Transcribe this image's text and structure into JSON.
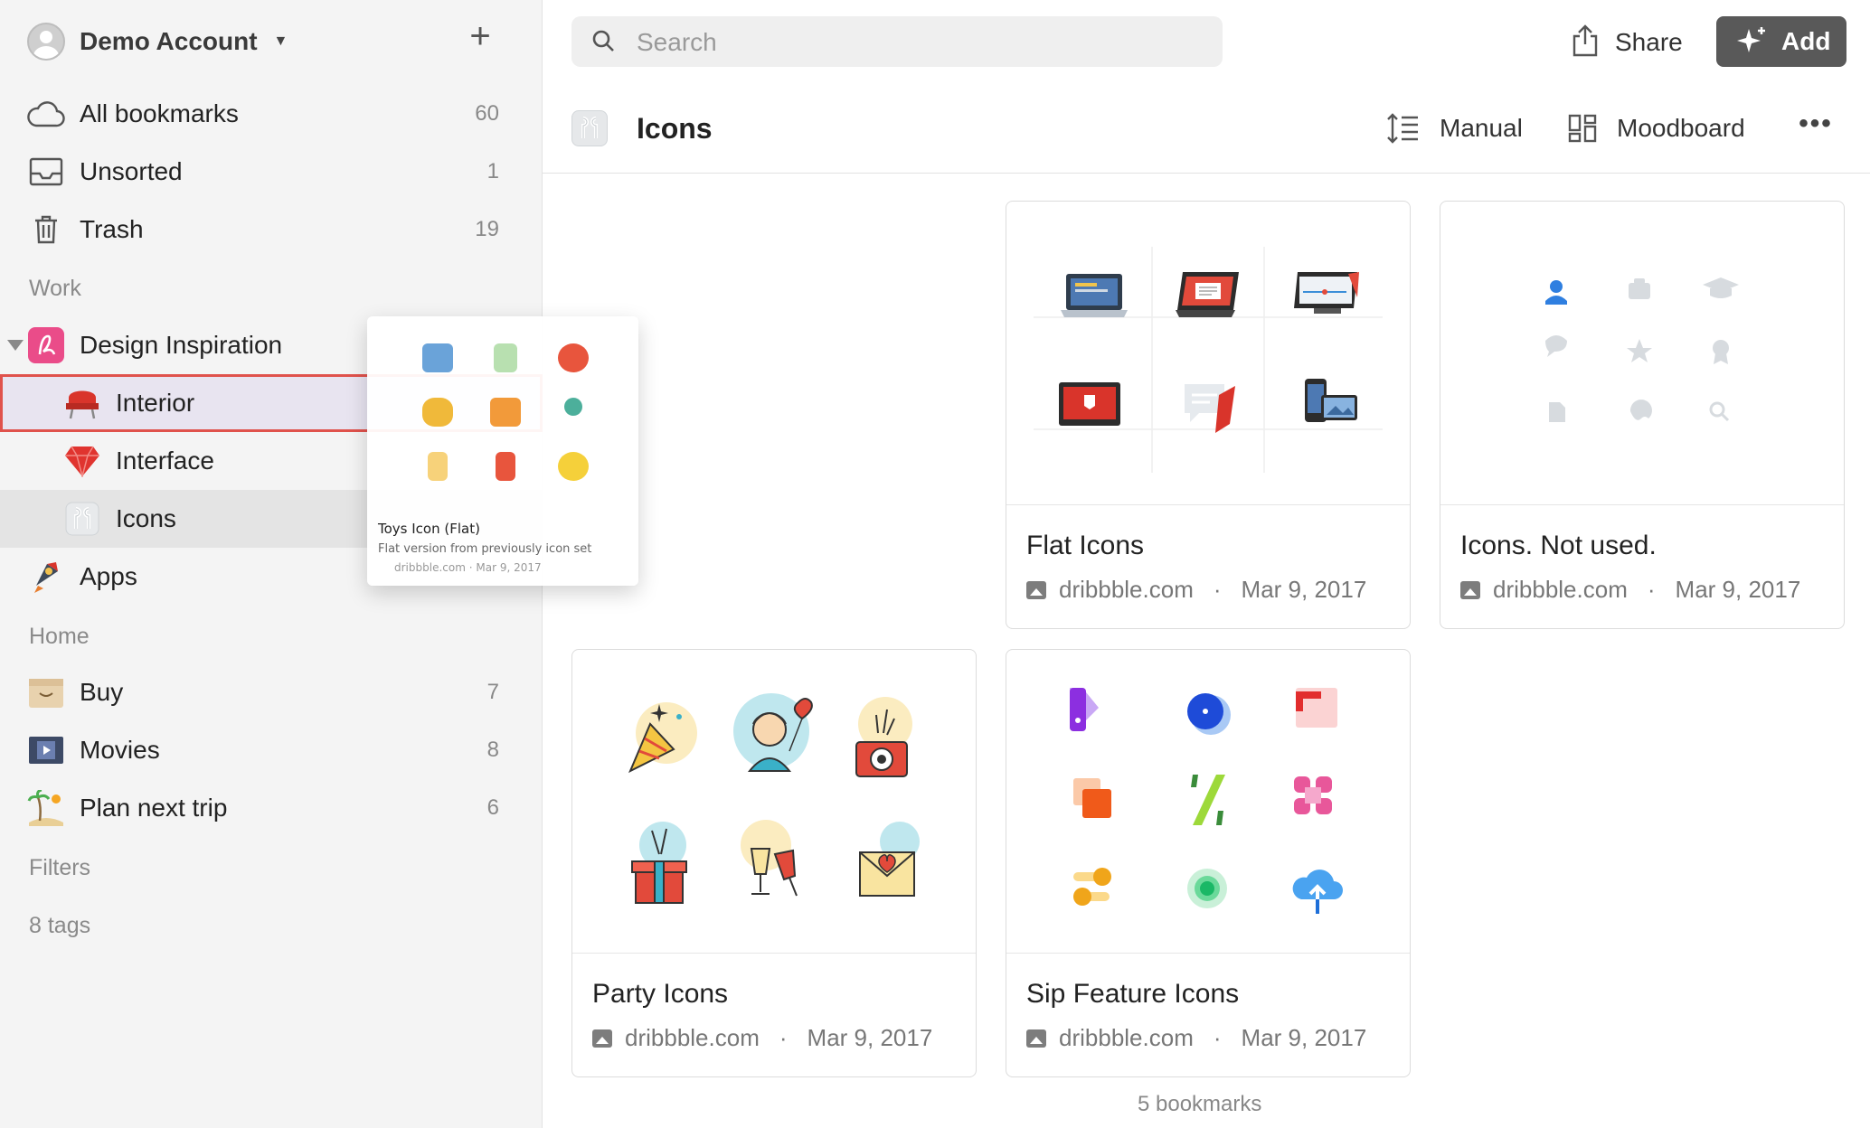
{
  "account": {
    "name": "Demo Account"
  },
  "sidebar": {
    "system": [
      {
        "label": "All bookmarks",
        "count": "60",
        "icon": "cloud-icon"
      },
      {
        "label": "Unsorted",
        "count": "1",
        "icon": "inbox-icon"
      },
      {
        "label": "Trash",
        "count": "19",
        "icon": "trash-icon"
      }
    ],
    "sections": {
      "work": "Work",
      "home": "Home",
      "filters": "Filters",
      "tags": "8 tags"
    },
    "work_items": [
      {
        "label": "Design Inspiration",
        "icon": "dribbble-icon"
      },
      {
        "label": "Interior",
        "icon": "chair-icon"
      },
      {
        "label": "Interface",
        "icon": "ruby-icon"
      },
      {
        "label": "Icons",
        "icon": "airpods-icon"
      },
      {
        "label": "Apps",
        "icon": "rocket-icon"
      }
    ],
    "home_items": [
      {
        "label": "Buy",
        "count": "7",
        "icon": "box-icon"
      },
      {
        "label": "Movies",
        "count": "8",
        "icon": "film-icon"
      },
      {
        "label": "Plan next trip",
        "count": "6",
        "icon": "beach-icon"
      }
    ]
  },
  "drag_preview": {
    "title": "Toys Icon (Flat)",
    "description": "Flat version from previously icon set",
    "domain": "dribbble.com",
    "date": "Mar 9, 2017"
  },
  "topbar": {
    "search_placeholder": "Search",
    "share_label": "Share",
    "add_label": "Add"
  },
  "header": {
    "title": "Icons",
    "sort_label": "Manual",
    "view_label": "Moodboard",
    "more_label": "•••"
  },
  "bookmarks": [
    {
      "title": "Flat Icons",
      "domain": "dribbble.com",
      "date": "Mar 9, 2017"
    },
    {
      "title": "Icons. Not used.",
      "domain": "dribbble.com",
      "date": "Mar 9, 2017"
    },
    {
      "title": "Party Icons",
      "domain": "dribbble.com",
      "date": "Mar 9, 2017"
    },
    {
      "title": "Sip Feature Icons",
      "domain": "dribbble.com",
      "date": "Mar 9, 2017"
    }
  ],
  "footer": {
    "count_label": "5 bookmarks"
  },
  "colors": {
    "sidebar_bg": "#f4f4f4",
    "accent_drop": "#e0524c",
    "add_button": "#595959",
    "dribbble_pink": "#ea4c89"
  }
}
